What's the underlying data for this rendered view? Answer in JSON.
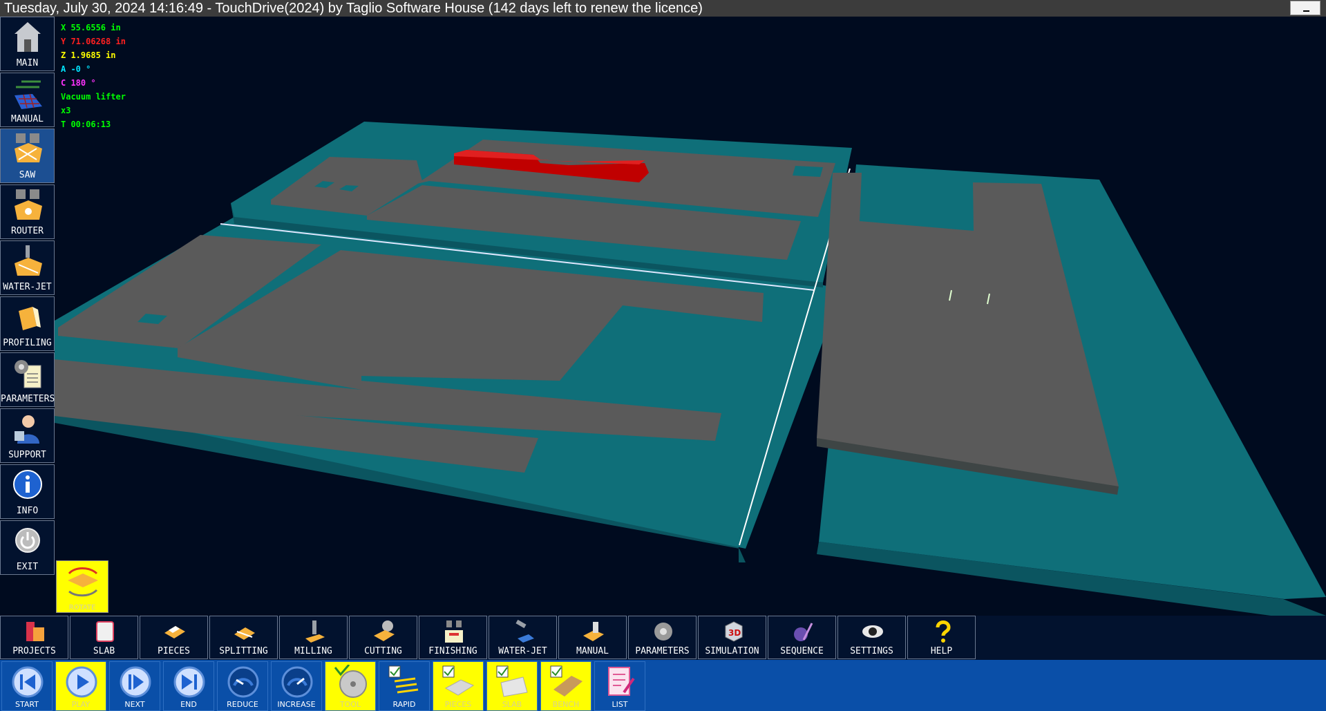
{
  "title": "Tuesday, July 30, 2024 14:16:49  - TouchDrive(2024) by Taglio Software House (142 days left to renew the licence)",
  "window_controls": {
    "minimize_icon": "minimize-icon"
  },
  "left_menu": [
    {
      "label": "MAIN",
      "icon": "home-icon",
      "active": false
    },
    {
      "label": "MANUAL",
      "icon": "manual-grid-icon",
      "active": false
    },
    {
      "label": "SAW",
      "icon": "saw-icon",
      "active": true
    },
    {
      "label": "ROUTER",
      "icon": "router-icon",
      "active": false
    },
    {
      "label": "WATER-JET",
      "icon": "water-jet-icon",
      "active": false
    },
    {
      "label": "PROFILING",
      "icon": "profiling-icon",
      "active": false
    },
    {
      "label": "PARAMETERS",
      "icon": "gears-icon",
      "active": false
    },
    {
      "label": "SUPPORT",
      "icon": "support-agent-icon",
      "active": false
    },
    {
      "label": "INFO",
      "icon": "info-icon",
      "active": false
    },
    {
      "label": "EXIT",
      "icon": "power-icon",
      "active": false
    }
  ],
  "readout": {
    "x": "X  55.6556 in",
    "y": "Y  71.06268 in",
    "z": "Z  1.9685 in",
    "a": "A -0 °",
    "c": "C  180 °",
    "tool": "Vacuum lifter",
    "speed": "x3",
    "time": "T 00:06:13"
  },
  "readout_colors": {
    "x": "#00ff00",
    "y": "#ff2020",
    "z": "#ffff00",
    "a": "#00e5ff",
    "c": "#ff33ff",
    "tool": "#00ff00",
    "speed": "#00ff00",
    "time": "#00ff00"
  },
  "rotate_button": {
    "label": "ROTATE",
    "icon": "rotate-icon"
  },
  "toolbar": [
    {
      "label": "PROJECTS",
      "icon": "projects-icon"
    },
    {
      "label": "SLAB",
      "icon": "slab-icon"
    },
    {
      "label": "PIECES",
      "icon": "pieces-icon"
    },
    {
      "label": "SPLITTING",
      "icon": "splitting-icon"
    },
    {
      "label": "MILLING",
      "icon": "milling-icon"
    },
    {
      "label": "CUTTING",
      "icon": "cutting-icon"
    },
    {
      "label": "FINISHING",
      "icon": "finishing-icon"
    },
    {
      "label": "WATER-JET",
      "icon": "water-jet-icon"
    },
    {
      "label": "MANUAL",
      "icon": "manual-icon"
    },
    {
      "label": "PARAMETERS",
      "icon": "gear-icon"
    },
    {
      "label": "SIMULATION",
      "icon": "3d-cube-icon"
    },
    {
      "label": "SEQUENCE",
      "icon": "iso-sequence-icon"
    },
    {
      "label": "SETTINGS",
      "icon": "eye-icon"
    },
    {
      "label": "HELP",
      "icon": "question-icon"
    }
  ],
  "playback": [
    {
      "label": "START",
      "icon": "skip-start-icon",
      "highlight": false
    },
    {
      "label": "PLAY",
      "icon": "play-icon",
      "highlight": true
    },
    {
      "label": "NEXT",
      "icon": "step-forward-icon",
      "highlight": false
    },
    {
      "label": "END",
      "icon": "skip-end-icon",
      "highlight": false
    },
    {
      "label": "REDUCE",
      "icon": "speed-down-icon",
      "highlight": false
    },
    {
      "label": "INCREASE",
      "icon": "speed-up-icon",
      "highlight": false
    },
    {
      "label": "TOOL",
      "icon": "saw-blade-icon",
      "highlight": true
    },
    {
      "label": "RAPID",
      "icon": "rapid-path-icon",
      "highlight": false
    },
    {
      "label": "PIECES",
      "icon": "pieces-check-icon",
      "highlight": true
    },
    {
      "label": "SLAB",
      "icon": "slab-check-icon",
      "highlight": true
    },
    {
      "label": "BENCH",
      "icon": "bench-check-icon",
      "highlight": true
    },
    {
      "label": "LIST",
      "icon": "list-icon",
      "highlight": false
    }
  ],
  "colors": {
    "titlebar": "#3c3c3c",
    "background": "#000b1f",
    "panel": "#02122e",
    "active": "#1c4f92",
    "playbar": "#0a4fa8",
    "slab": "#0f6f79",
    "piece": "#5a5a5a",
    "tool": "#c00000"
  }
}
